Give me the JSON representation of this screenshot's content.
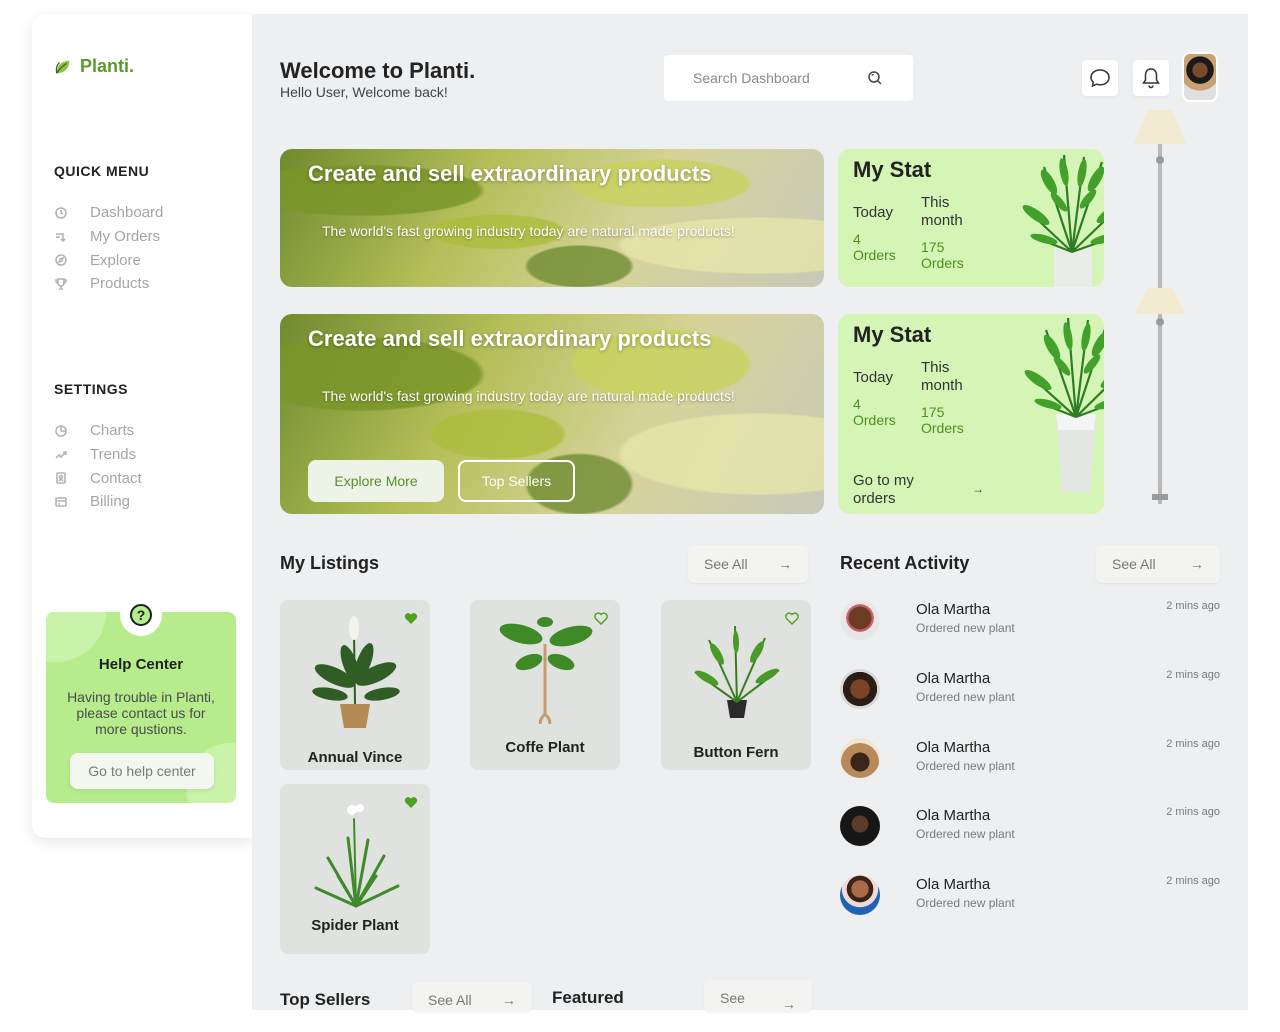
{
  "brand": {
    "name": "Planti."
  },
  "sidebar": {
    "quick_menu_title": "QUICK MENU",
    "quick_menu": [
      {
        "label": "Dashboard",
        "icon": "dashboard-icon"
      },
      {
        "label": "My Orders",
        "icon": "orders-icon"
      },
      {
        "label": "Explore",
        "icon": "compass-icon"
      },
      {
        "label": "Products",
        "icon": "trophy-icon"
      }
    ],
    "settings_title": "SETTINGS",
    "settings_menu": [
      {
        "label": "Charts",
        "icon": "pie-chart-icon"
      },
      {
        "label": "Trends",
        "icon": "trend-icon"
      },
      {
        "label": "Contact",
        "icon": "contact-icon"
      },
      {
        "label": "Billing",
        "icon": "billing-icon"
      }
    ],
    "help": {
      "badge": "?",
      "title": "Help Center",
      "text": "Having trouble in Planti, please contact us for more qustions.",
      "button": "Go to help center"
    }
  },
  "header": {
    "title": "Welcome to Planti.",
    "subtitle": "Hello User, Welcome back!",
    "search_placeholder": "Search Dashboard"
  },
  "banners": [
    {
      "title": "Create and sell extraordinary products",
      "desc": "The world's fast growing industry today are natural made products!"
    },
    {
      "title": "Create and sell extraordinary products",
      "desc": "The world's fast growing industry today are natural made products!",
      "explore_button": "Explore More",
      "sellers_button": "Top Sellers"
    }
  ],
  "stats": [
    {
      "title": "My Stat",
      "today_label": "Today",
      "today_value": "4 Orders",
      "month_label": "This month",
      "month_value": "175 Orders"
    },
    {
      "title": "My Stat",
      "today_label": "Today",
      "today_value": "4 Orders",
      "month_label": "This month",
      "month_value": "175 Orders",
      "link": "Go to my orders",
      "arrow": "→"
    }
  ],
  "listings": {
    "title": "My Listings",
    "see_all": "See All",
    "arrow": "→",
    "items": [
      {
        "name": "Annual Vince",
        "favorite": true
      },
      {
        "name": "Coffe Plant",
        "favorite": false
      },
      {
        "name": "Button Fern",
        "favorite": false
      },
      {
        "name": "Spider Plant",
        "favorite": true
      }
    ]
  },
  "activity": {
    "title": "Recent Activity",
    "see_all": "See All",
    "arrow": "→",
    "items": [
      {
        "name": "Ola Martha",
        "desc": "Ordered new plant",
        "time": "2 mins ago"
      },
      {
        "name": "Ola Martha",
        "desc": "Ordered new plant",
        "time": "2 mins ago"
      },
      {
        "name": "Ola Martha",
        "desc": "Ordered new plant",
        "time": "2 mins ago"
      },
      {
        "name": "Ola Martha",
        "desc": "Ordered new plant",
        "time": "2 mins ago"
      },
      {
        "name": "Ola Martha",
        "desc": "Ordered new plant",
        "time": "2 mins ago"
      }
    ]
  },
  "bottom": {
    "top_sellers": "Top Sellers",
    "top_sellers_see_all": "See All",
    "arrow": "→",
    "featured": "Featured",
    "featured_see": "See"
  },
  "colors": {
    "accent": "#5a9a2a",
    "stat_bg": "#d4f5b6",
    "help_bg": "#b7ec8c",
    "main_bg": "#eeeff0"
  }
}
